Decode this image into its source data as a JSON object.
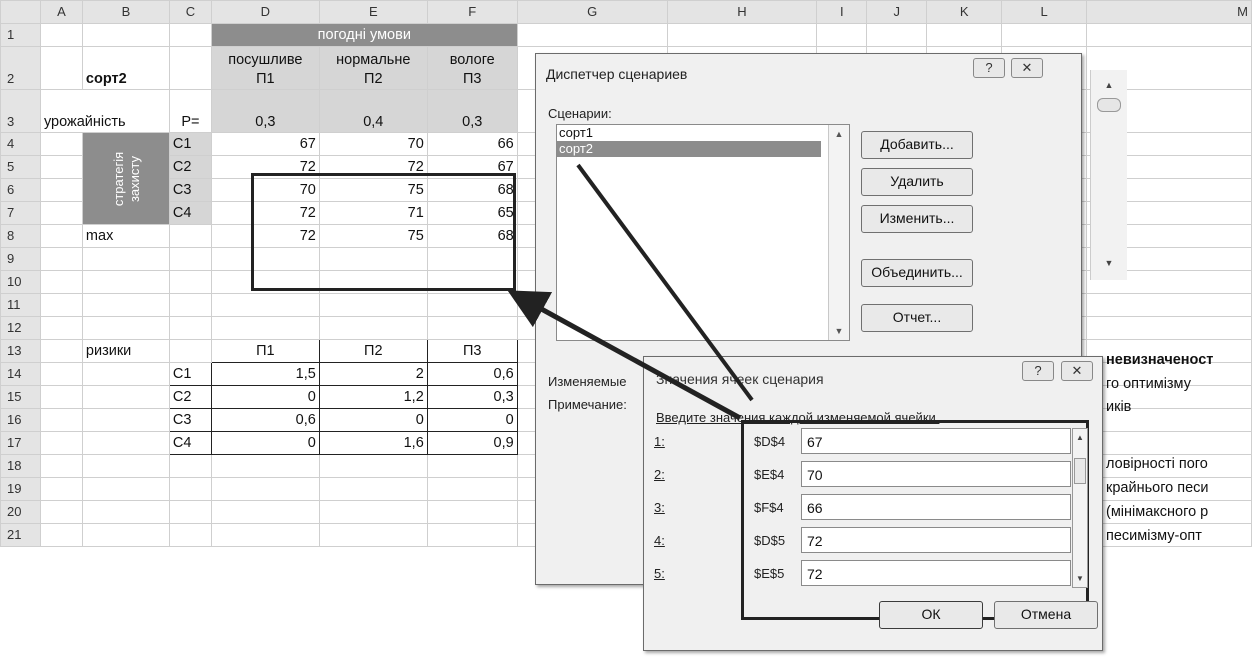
{
  "columns": [
    "A",
    "B",
    "C",
    "D",
    "E",
    "F",
    "G",
    "H",
    "I",
    "J",
    "K",
    "L",
    "M"
  ],
  "rows": [
    "1",
    "2",
    "3",
    "4",
    "5",
    "6",
    "7",
    "8",
    "9",
    "10",
    "11",
    "12",
    "13",
    "14",
    "15",
    "16",
    "17",
    "18",
    "19",
    "20",
    "21"
  ],
  "cells": {
    "weather_header": "погодні умови",
    "b2": "сорт2",
    "d2_top": "посушливе",
    "d2_bot": "П1",
    "e2_top": "нормальне",
    "e2_bot": "П2",
    "f2_top": "вологе",
    "f2_bot": "П3",
    "a3": "урожайність",
    "c3": "P=",
    "d3": "0,3",
    "e3": "0,4",
    "f3": "0,3",
    "strategy": "стратегія захисту",
    "c4": "С1",
    "c5": "С2",
    "c6": "С3",
    "c7": "С4",
    "d4": "67",
    "e4": "70",
    "f4": "66",
    "d5": "72",
    "e5": "72",
    "f5": "67",
    "d6": "70",
    "e6": "75",
    "f6": "68",
    "d7": "72",
    "e7": "71",
    "f7": "65",
    "b8": "max",
    "d8": "72",
    "e8": "75",
    "f8": "68",
    "b13": "ризики",
    "d13": "П1",
    "e13": "П2",
    "f13": "П3",
    "c14": "С1",
    "d14": "1,5",
    "e14": "2",
    "f14": "0,6",
    "c15": "С2",
    "d15": "0",
    "e15": "1,2",
    "f15": "0,3",
    "c16": "С3",
    "d16": "0,6",
    "e16": "0",
    "f16": "0",
    "c17": "С4",
    "d17": "0",
    "e17": "1,6",
    "f17": "0,9",
    "l10": "невизначеност",
    "l11": "го оптимізму",
    "l12": "иків",
    "l14": "ловірності пого",
    "l15": "крайнього песи",
    "l16": "(мінімаксного р",
    "l17": "песимізму-опт"
  },
  "scenario_manager": {
    "title": "Диспетчер сценариев",
    "help": "?",
    "close": "✕",
    "scenarios_label": "Сценарии:",
    "scenarios": [
      "сорт1",
      "сорт2"
    ],
    "selected": "сорт2",
    "buttons": {
      "add": "Добавить...",
      "delete": "Удалить",
      "edit": "Изменить...",
      "merge": "Объединить...",
      "report": "Отчет..."
    },
    "changing_label": "Изменяемые",
    "comment_label": "Примечание:"
  },
  "scenario_values": {
    "title": "Значения ячеек сценария",
    "help": "?",
    "close": "✕",
    "prompt": "Введите значения каждой изменяемой ячейки.",
    "rows": [
      {
        "n": "1:",
        "ref": "$D$4",
        "value": "67"
      },
      {
        "n": "2:",
        "ref": "$E$4",
        "value": "70"
      },
      {
        "n": "3:",
        "ref": "$F$4",
        "value": "66"
      },
      {
        "n": "4:",
        "ref": "$D$5",
        "value": "72"
      },
      {
        "n": "5:",
        "ref": "$E$5",
        "value": "72"
      }
    ],
    "ok": "ОК",
    "cancel": "Отмена"
  }
}
